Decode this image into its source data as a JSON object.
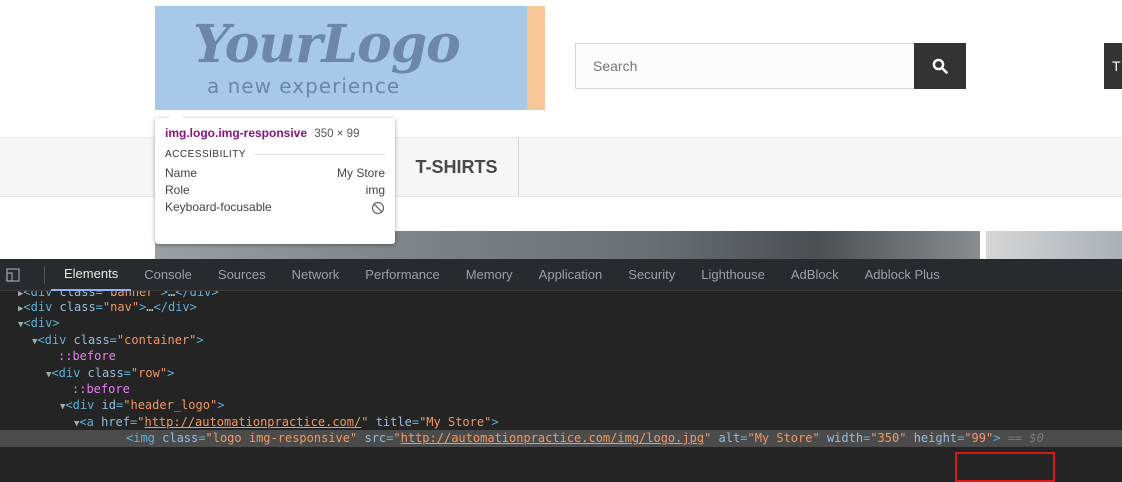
{
  "site": {
    "logo": {
      "script_text": "YourLogo",
      "tagline": "a new experience"
    },
    "search": {
      "placeholder": "Search"
    },
    "menu": {
      "tshirts": "T-SHIRTS"
    }
  },
  "tooltip": {
    "selector": "img.logo.img-responsive",
    "dimensions": "350 × 99",
    "section": "ACCESSIBILITY",
    "rows": [
      {
        "label": "Name",
        "value": "My Store"
      },
      {
        "label": "Role",
        "value": "img"
      },
      {
        "label": "Keyboard-focusable",
        "value": ""
      }
    ]
  },
  "devtools": {
    "tabs": [
      "Elements",
      "Console",
      "Sources",
      "Network",
      "Performance",
      "Memory",
      "Application",
      "Security",
      "Lighthouse",
      "AdBlock",
      "Adblock Plus"
    ],
    "active_tab": "Elements",
    "dom": {
      "banner_class": "banner",
      "nav_class": "nav",
      "container_class": "container",
      "row_class": "row",
      "header_id": "header_logo",
      "link_href": "http://automationpractice.com/",
      "link_title": "My Store",
      "img_class": "logo img-responsive",
      "img_src": "http://automationpractice.com/img/logo.jpg",
      "img_alt": "My Store",
      "img_width": "350",
      "img_height": "99",
      "selection_marker": "== $0",
      "ellipsis": "…",
      "pseudo_before": "::before"
    }
  },
  "colors": {
    "highlight_box": "#d91818",
    "active_tab_underline": "#8ab4f8"
  }
}
